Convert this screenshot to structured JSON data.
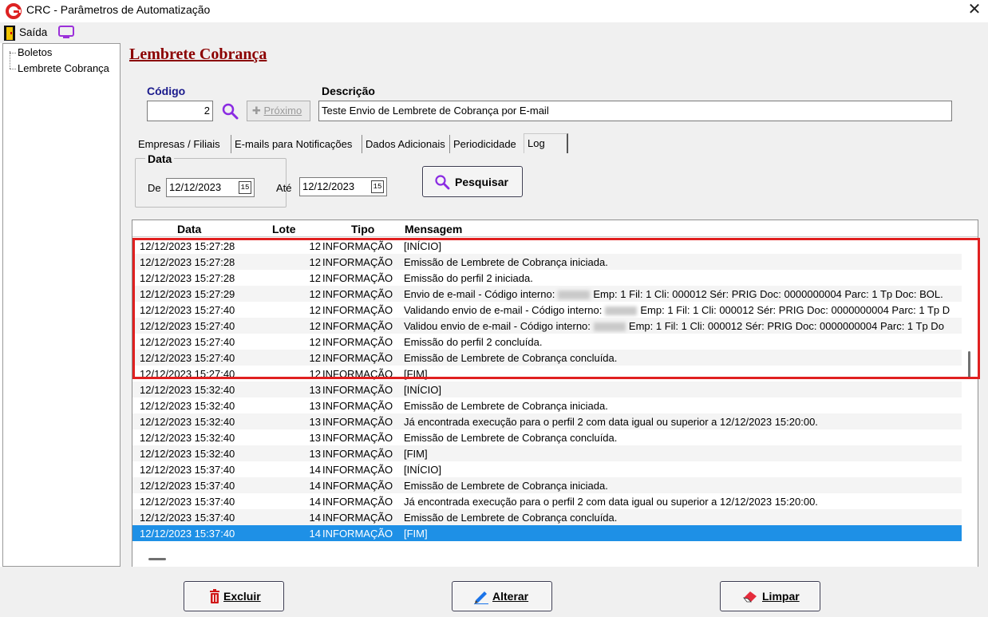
{
  "window": {
    "title": "CRC - Parâmetros de Automatização",
    "close_symbol": "✕"
  },
  "menu": {
    "exit_label": "Saída"
  },
  "sidebar": {
    "items": [
      {
        "label": "Boletos"
      },
      {
        "label": "Lembrete Cobrança"
      }
    ]
  },
  "form": {
    "title": "Lembrete Cobrança",
    "code_label": "Código",
    "code_value": "2",
    "next_button": "Próximo",
    "description_label": "Descrição",
    "description_value": "Teste Envio de Lembrete de Cobrança por E-mail"
  },
  "tabs": [
    {
      "label": "Empresas / Filiais"
    },
    {
      "label": "E-mails para Notificações"
    },
    {
      "label": "Dados Adicionais"
    },
    {
      "label": "Periodicidade"
    },
    {
      "label": "Log",
      "active": true
    }
  ],
  "filter": {
    "legend": "Data",
    "from_label": "De",
    "from_value": "12/12/2023",
    "to_label": "Até",
    "to_value": "12/12/2023",
    "calendar_glyph": "15",
    "search_button": "Pesquisar"
  },
  "log": {
    "columns": {
      "data": "Data",
      "lote": "Lote",
      "tipo": "Tipo",
      "mensagem": "Mensagem"
    },
    "rows": [
      {
        "data": "12/12/2023 15:27:28",
        "lote": "12",
        "tipo": "INFORMAÇÃO",
        "msg": "[INÍCIO]"
      },
      {
        "data": "12/12/2023 15:27:28",
        "lote": "12",
        "tipo": "INFORMAÇÃO",
        "msg": "Emissão de Lembrete de Cobrança iniciada."
      },
      {
        "data": "12/12/2023 15:27:28",
        "lote": "12",
        "tipo": "INFORMAÇÃO",
        "msg": "Emissão do perfil 2 iniciada."
      },
      {
        "data": "12/12/2023 15:27:29",
        "lote": "12",
        "tipo": "INFORMAÇÃO",
        "msg": "Envio de e-mail - Código interno:",
        "msg_after": "Emp: 1 Fil: 1 Cli: 000012 Sér: PRIG Doc: 0000000004 Parc: 1 Tp Doc: BOL.",
        "redacted": true
      },
      {
        "data": "12/12/2023 15:27:40",
        "lote": "12",
        "tipo": "INFORMAÇÃO",
        "msg": "Validando envio de e-mail - Código interno:",
        "msg_after": "Emp: 1 Fil: 1 Cli: 000012 Sér: PRIG Doc: 0000000004 Parc: 1 Tp D",
        "redacted": true
      },
      {
        "data": "12/12/2023 15:27:40",
        "lote": "12",
        "tipo": "INFORMAÇÃO",
        "msg": "Validou envio de e-mail - Código interno:",
        "msg_after": "Emp: 1 Fil: 1 Cli: 000012 Sér: PRIG Doc: 0000000004 Parc: 1 Tp Do",
        "redacted": true
      },
      {
        "data": "12/12/2023 15:27:40",
        "lote": "12",
        "tipo": "INFORMAÇÃO",
        "msg": "Emissão do perfil 2 concluída."
      },
      {
        "data": "12/12/2023 15:27:40",
        "lote": "12",
        "tipo": "INFORMAÇÃO",
        "msg": "Emissão de Lembrete de Cobrança concluída."
      },
      {
        "data": "12/12/2023 15:27:40",
        "lote": "12",
        "tipo": "INFORMAÇÃO",
        "msg": "[FIM]"
      },
      {
        "data": "12/12/2023 15:32:40",
        "lote": "13",
        "tipo": "INFORMAÇÃO",
        "msg": "[INÍCIO]"
      },
      {
        "data": "12/12/2023 15:32:40",
        "lote": "13",
        "tipo": "INFORMAÇÃO",
        "msg": "Emissão de Lembrete de Cobrança iniciada."
      },
      {
        "data": "12/12/2023 15:32:40",
        "lote": "13",
        "tipo": "INFORMAÇÃO",
        "msg": "Já encontrada execução para o perfil 2 com data igual ou superior a 12/12/2023 15:20:00."
      },
      {
        "data": "12/12/2023 15:32:40",
        "lote": "13",
        "tipo": "INFORMAÇÃO",
        "msg": "Emissão de Lembrete de Cobrança concluída."
      },
      {
        "data": "12/12/2023 15:32:40",
        "lote": "13",
        "tipo": "INFORMAÇÃO",
        "msg": "[FIM]"
      },
      {
        "data": "12/12/2023 15:37:40",
        "lote": "14",
        "tipo": "INFORMAÇÃO",
        "msg": "[INÍCIO]"
      },
      {
        "data": "12/12/2023 15:37:40",
        "lote": "14",
        "tipo": "INFORMAÇÃO",
        "msg": "Emissão de Lembrete de Cobrança iniciada."
      },
      {
        "data": "12/12/2023 15:37:40",
        "lote": "14",
        "tipo": "INFORMAÇÃO",
        "msg": "Já encontrada execução para o perfil 2 com data igual ou superior a 12/12/2023 15:20:00."
      },
      {
        "data": "12/12/2023 15:37:40",
        "lote": "14",
        "tipo": "INFORMAÇÃO",
        "msg": "Emissão de Lembrete de Cobrança concluída."
      },
      {
        "data": "12/12/2023 15:37:40",
        "lote": "14",
        "tipo": "INFORMAÇÃO",
        "msg": "[FIM]",
        "selected": true
      }
    ]
  },
  "actions": {
    "delete": "Excluir",
    "edit": "Alterar",
    "clear": "Limpar"
  },
  "colors": {
    "title": "#8b0000",
    "accent": "#1e90e6",
    "highlight": "#e02020",
    "icon_purple": "#8a2be2",
    "delete_red": "#d01818"
  }
}
